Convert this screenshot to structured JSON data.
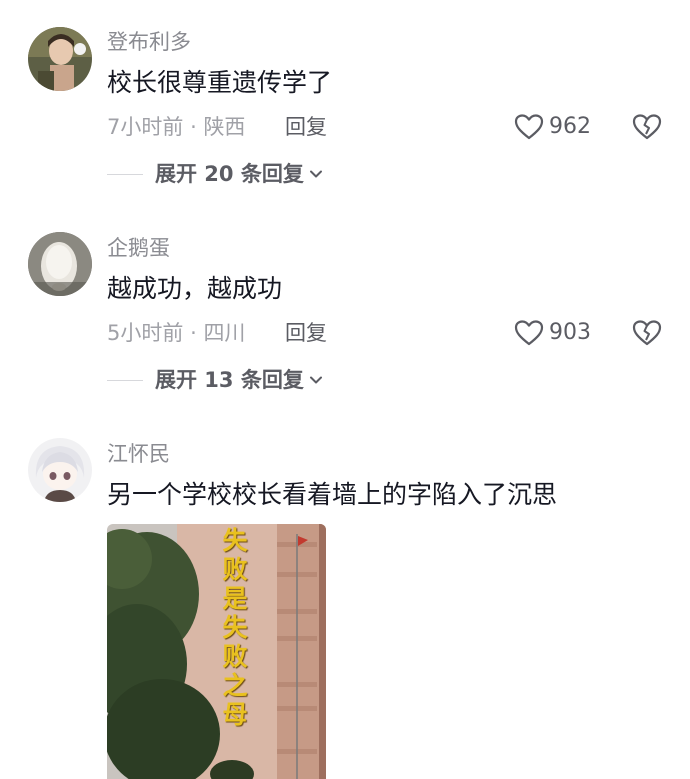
{
  "comments": [
    {
      "username": "登布利多",
      "text": "校长很尊重遗传学了",
      "time": "7小时前",
      "location": "陕西",
      "reply_label": "回复",
      "likes": "962",
      "expand_label": "展开 20 条回复"
    },
    {
      "username": "企鹅蛋",
      "text": "越成功，越成功",
      "time": "5小时前",
      "location": "四川",
      "reply_label": "回复",
      "likes": "903",
      "expand_label": "展开 13 条回复"
    },
    {
      "username": "江怀民",
      "text": "另一个学校校长看着墙上的字陷入了沉思",
      "image_slogan": "失败是失败之母"
    }
  ],
  "meta_separator": "·",
  "icons": {
    "like": "heart-outline-icon",
    "dislike": "broken-heart-icon",
    "expand": "chevron-down-icon"
  },
  "colors": {
    "text_primary": "#161823",
    "text_secondary": "#8a8b91",
    "slogan": "#e9c11f"
  }
}
